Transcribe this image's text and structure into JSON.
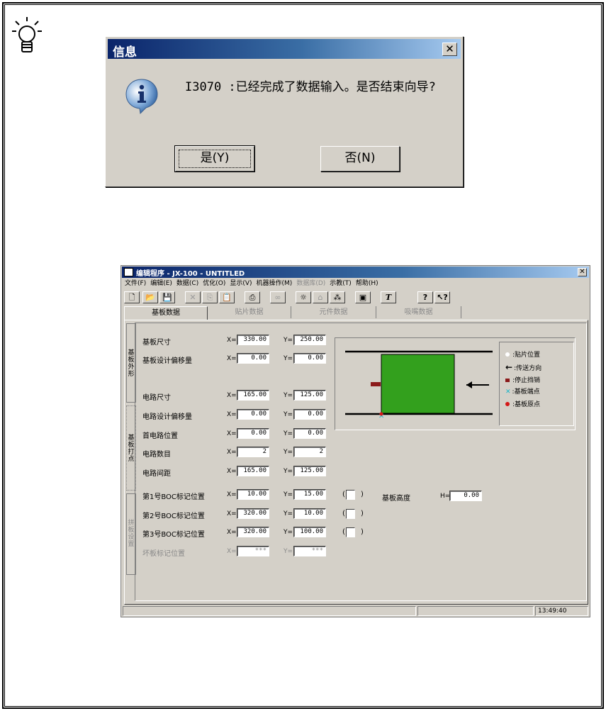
{
  "dialog": {
    "title": "信息",
    "close_glyph": "✕",
    "icon": "info-icon",
    "message": "I3070 :已经完成了数据输入。是否结束向导?",
    "yes_label": "是(Y)",
    "no_label": "否(N)"
  },
  "app": {
    "title": "编辑程序 - JX-100 - UNTITLED",
    "close_glyph": "✕",
    "menu": [
      {
        "label": "文件(F)",
        "enabled": true
      },
      {
        "label": "编辑(E)",
        "enabled": true
      },
      {
        "label": "数据(C)",
        "enabled": true
      },
      {
        "label": "优化(O)",
        "enabled": true
      },
      {
        "label": "显示(V)",
        "enabled": true
      },
      {
        "label": "机器操作(M)",
        "enabled": true
      },
      {
        "label": "数据库(D)",
        "enabled": false
      },
      {
        "label": "示教(T)",
        "enabled": true
      },
      {
        "label": "帮助(H)",
        "enabled": true
      }
    ],
    "tabs": [
      {
        "label": "基板数据",
        "active": true
      },
      {
        "label": "贴片数据",
        "active": false
      },
      {
        "label": "元件数据",
        "active": false
      },
      {
        "label": "吸嘴数据",
        "active": false
      }
    ],
    "side_tabs": [
      {
        "label": "基板外形",
        "enabled": true
      },
      {
        "label": "基板打点",
        "enabled": true
      },
      {
        "label": "拼板设置",
        "enabled": false
      }
    ],
    "rows": [
      {
        "label": "基板尺寸",
        "x": "330.00",
        "y": "250.00",
        "enabled": true
      },
      {
        "label": "基板设计偏移量",
        "x": "0.00",
        "y": "0.00",
        "enabled": true
      },
      {
        "label": "电路尺寸",
        "x": "165.00",
        "y": "125.00",
        "enabled": true
      },
      {
        "label": "电路设计偏移量",
        "x": "0.00",
        "y": "0.00",
        "enabled": true
      },
      {
        "label": "首电路位置",
        "x": "0.00",
        "y": "0.00",
        "enabled": true
      },
      {
        "label": "电路数目",
        "x": "2",
        "y": "2",
        "enabled": true
      },
      {
        "label": "电路间距",
        "x": "165.00",
        "y": "125.00",
        "enabled": true
      },
      {
        "label": "第1号BOC标记位置",
        "x": "10.00",
        "y": "15.00",
        "enabled": true
      },
      {
        "label": "第2号BOC标记位置",
        "x": "320.00",
        "y": "10.00",
        "enabled": true
      },
      {
        "label": "第3号BOC标记位置",
        "x": "320.00",
        "y": "100.00",
        "enabled": true
      },
      {
        "label": "坏板标记位置",
        "x": "***",
        "y": "***",
        "enabled": false
      }
    ],
    "x_prefix": "X=",
    "y_prefix": "Y=",
    "h_prefix": "H=",
    "paren_open": "(",
    "paren_close": ")",
    "board_height_label": "基板高度",
    "board_height_value": "0.00",
    "legend": [
      {
        "icon": "white-dot-icon",
        "label": ":贴片位置"
      },
      {
        "icon": "arrow-left-icon",
        "label": ":传送方向"
      },
      {
        "icon": "stop-pin-icon",
        "label": ":停止挡销"
      },
      {
        "icon": "board-end-icon",
        "label": ":基板端点"
      },
      {
        "icon": "origin-dot-icon",
        "label": ":基板原点"
      }
    ],
    "colors": {
      "board_green": "#33a01d",
      "stop_pin": "#8b1a1a",
      "title_blue": "#0a246a",
      "face": "#d4d0c8"
    },
    "status_time": "13:49:40"
  }
}
